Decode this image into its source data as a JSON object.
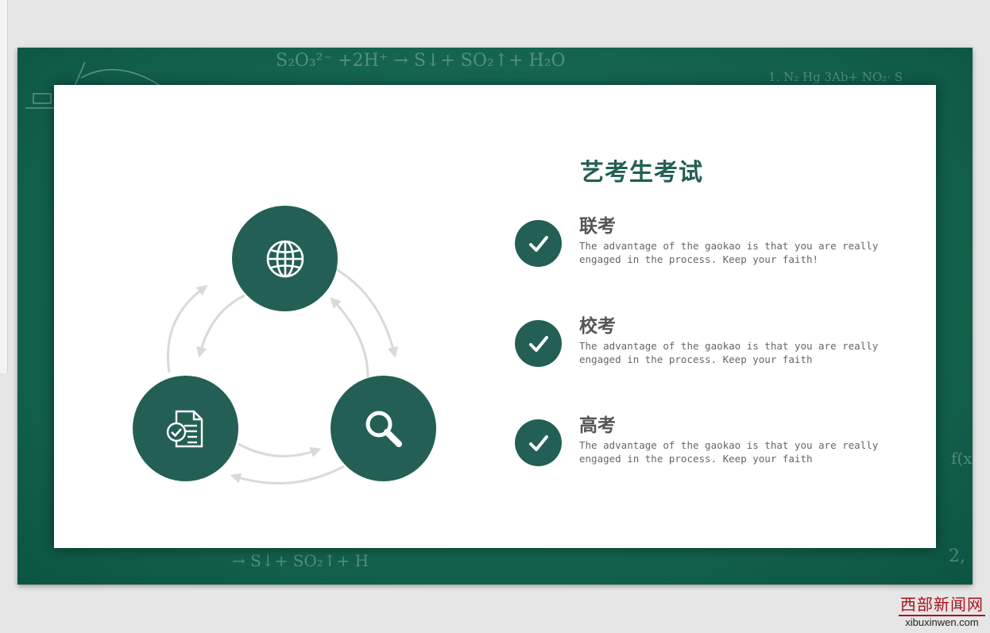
{
  "slide": {
    "background_color": "#146550",
    "chalk_marks": [
      "S₂O₃²⁻ +2H⁺ → S↓+ SO₂↑+ H₂O",
      "1. N₂  Hg  3Ab+  NO₂·   S",
      "→ S↓+ SO₂↑+ H",
      "f(x) =",
      "2,"
    ]
  },
  "title": "艺考生考试",
  "items": [
    {
      "title": "联考",
      "desc": "The advantage of the gaokao is that you are really engaged in the process. Keep your faith!"
    },
    {
      "title": "校考",
      "desc": "The advantage of the gaokao is that you are really engaged in the process. Keep your faith"
    },
    {
      "title": "高考",
      "desc": "The advantage of the gaokao is that you are really engaged in the process. Keep your faith"
    }
  ],
  "cycle_icons": [
    "globe-icon",
    "document-check-icon",
    "magnifier-icon"
  ],
  "colors": {
    "accent": "#235f54",
    "arrow": "#d9d9d9",
    "text": "#555555"
  },
  "watermark": {
    "cn": "西部新闻网",
    "en": "xibuxinwen.com"
  }
}
